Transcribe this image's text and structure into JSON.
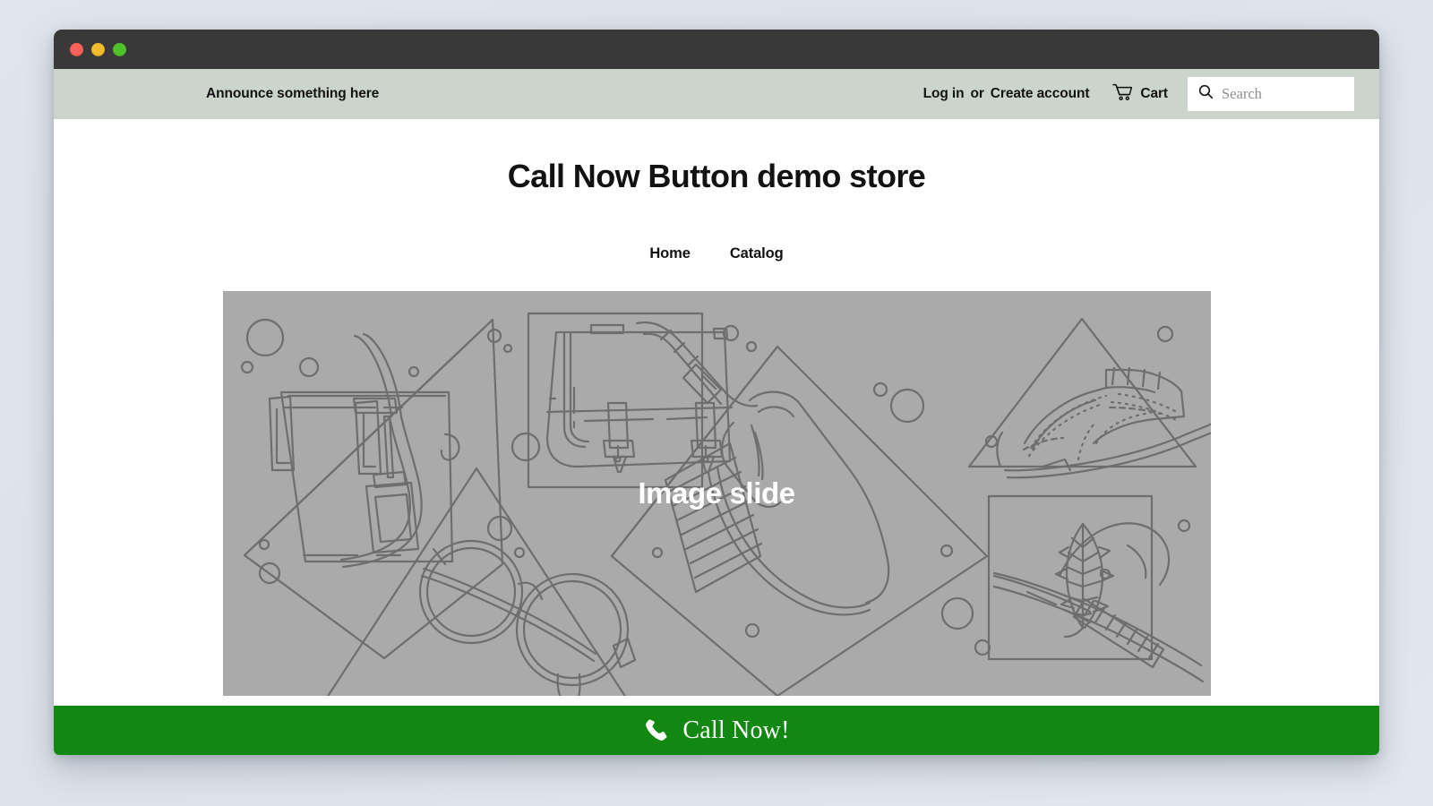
{
  "window": {
    "traffic_lights": [
      {
        "name": "close",
        "color": "#f9615a"
      },
      {
        "name": "minimize",
        "color": "#f0bc2b"
      },
      {
        "name": "zoom",
        "color": "#50c22c"
      }
    ],
    "chrome_color": "#393939",
    "page_background": "#dde3ea"
  },
  "announcement": {
    "text": "Announce something here",
    "bar_color": "#ccd5cc"
  },
  "account_nav": {
    "login_label": "Log in",
    "separator": "or",
    "create_account_label": "Create account",
    "cart_label": "Cart",
    "cart_icon": "shopping-cart-icon"
  },
  "search": {
    "placeholder": "Search",
    "value": "",
    "icon": "search-icon"
  },
  "store": {
    "title": "Call Now Button demo store",
    "nav": [
      {
        "label": "Home"
      },
      {
        "label": "Catalog"
      }
    ]
  },
  "hero": {
    "caption": "Image slide",
    "background_color": "#aaaaaa",
    "line_color": "#6e6e6e",
    "illustration": "fashion-accessories-line-art"
  },
  "call_now": {
    "label": "Call Now!",
    "icon": "phone-icon",
    "bar_color": "#128712",
    "text_color": "#ffffff"
  }
}
